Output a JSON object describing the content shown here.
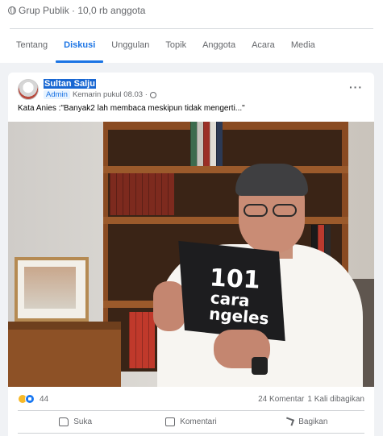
{
  "group": {
    "meta": "Grup Publik · 10,0 rb anggota",
    "tabs": [
      {
        "label": "Tentang"
      },
      {
        "label": "Diskusi"
      },
      {
        "label": "Unggulan"
      },
      {
        "label": "Topik"
      },
      {
        "label": "Anggota"
      },
      {
        "label": "Acara"
      },
      {
        "label": "Media"
      }
    ],
    "active_tab": "Diskusi"
  },
  "post": {
    "author": "Sultan Salju",
    "badge": "Admin",
    "time": "Kemarin pukul 08.03 ·",
    "more_label": "···",
    "caption": "Kata Anies :\"Banyak2 lah membaca meskipun tidak mengerti...\"",
    "image": {
      "book_line1": "101",
      "book_line2": "cara ngeles"
    },
    "reactions": {
      "count": "44",
      "types": [
        "haha",
        "like"
      ]
    },
    "comments": "24 Komentar",
    "shares": "1 Kali dibagikan",
    "actions": [
      {
        "label": "Suka",
        "icon": "like-icon"
      },
      {
        "label": "Komentari",
        "icon": "comment-icon"
      },
      {
        "label": "Bagikan",
        "icon": "share-icon"
      }
    ]
  },
  "colors": {
    "accent": "#1b74e4",
    "background": "#f0f2f5",
    "muted_text": "#65676b"
  }
}
